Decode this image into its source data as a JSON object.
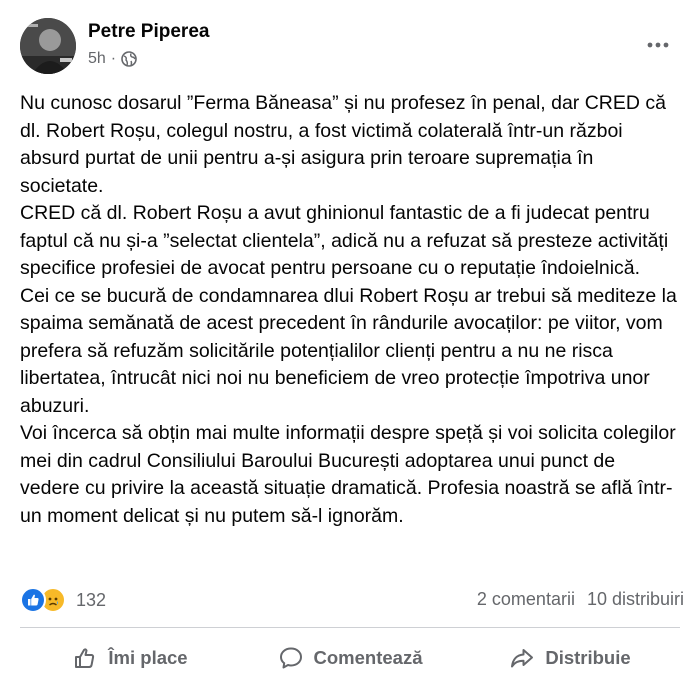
{
  "post": {
    "author": "Petre Piperea",
    "time": "5h",
    "separator": "·",
    "paragraphs": [
      "Nu cunosc dosarul ”Ferma Băneasa” și nu profesez în penal, dar CRED că dl. Robert Roșu, colegul nostru, a fost victimă colaterală într-un război absurd purtat de unii pentru a-și asigura prin teroare supremația în societate.",
      "CRED că dl. Robert Roșu a avut ghinionul fantastic de a fi judecat pentru faptul că nu și-a ”selectat clientela”, adică nu a refuzat să presteze activități specifice profesiei de avocat pentru persoane cu o reputație îndoielnică.",
      "Cei ce se bucură de condamnarea dlui Robert Roșu ar trebui să mediteze la spaima semănată de acest precedent în rândurile avocaților: pe viitor, vom prefera să refuzăm solicitările potențialilor clienți pentru a nu ne risca libertatea, întrucât nici noi nu beneficiem de vreo protecție împotriva unor abuzuri.",
      "Voi încerca să obțin mai multe informații despre speță și voi solicita colegilor mei din cadrul Consiliului Baroului București adoptarea unui punct de vedere cu privire la această situație dramatică. Profesia noastră se află într-un moment delicat și nu putem să-l ignorăm."
    ]
  },
  "reactions": {
    "icons": [
      "like-icon",
      "sad-icon"
    ],
    "count": "132",
    "comments": "2 comentarii",
    "shares": "10 distribuiri"
  },
  "actions": {
    "like": "Îmi place",
    "comment": "Comentează",
    "share": "Distribuie"
  },
  "colors": {
    "text": "#050505",
    "secondary": "#65676b",
    "like_blue": "#1b74e4",
    "sad_yellow": "#f7b928",
    "divider": "#ced0d4"
  }
}
